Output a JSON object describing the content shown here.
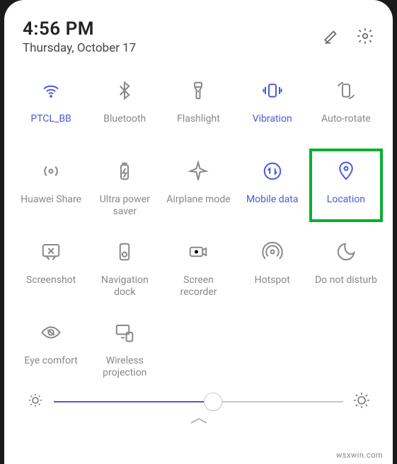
{
  "header": {
    "time": "4:56 PM",
    "date": "Thursday, October 17"
  },
  "tiles": [
    {
      "id": "wifi",
      "label": "PTCL_BB",
      "icon": "wifi",
      "active": true,
      "highlight": false
    },
    {
      "id": "bluetooth",
      "label": "Bluetooth",
      "icon": "bluetooth",
      "active": false,
      "highlight": false
    },
    {
      "id": "flashlight",
      "label": "Flashlight",
      "icon": "flashlight",
      "active": false,
      "highlight": false
    },
    {
      "id": "vibration",
      "label": "Vibration",
      "icon": "vibration",
      "active": true,
      "highlight": false
    },
    {
      "id": "autorotate",
      "label": "Auto-rotate",
      "icon": "autorotate",
      "active": false,
      "highlight": false
    },
    {
      "id": "huawei-share",
      "label": "Huawei Share",
      "icon": "huaweishare",
      "active": false,
      "highlight": false
    },
    {
      "id": "ultra-power",
      "label": "Ultra power\nsaver",
      "icon": "battery",
      "active": false,
      "highlight": false
    },
    {
      "id": "airplane",
      "label": "Airplane mode",
      "icon": "airplane",
      "active": false,
      "highlight": false
    },
    {
      "id": "mobile-data",
      "label": "Mobile data",
      "icon": "mobiledata",
      "active": true,
      "highlight": false
    },
    {
      "id": "location",
      "label": "Location",
      "icon": "location",
      "active": true,
      "highlight": true
    },
    {
      "id": "screenshot",
      "label": "Screenshot",
      "icon": "screenshot",
      "active": false,
      "highlight": false
    },
    {
      "id": "nav-dock",
      "label": "Navigation\ndock",
      "icon": "navdock",
      "active": false,
      "highlight": false
    },
    {
      "id": "screen-rec",
      "label": "Screen\nrecorder",
      "icon": "screenrec",
      "active": false,
      "highlight": false
    },
    {
      "id": "hotspot",
      "label": "Hotspot",
      "icon": "hotspot",
      "active": false,
      "highlight": false
    },
    {
      "id": "dnd",
      "label": "Do not disturb",
      "icon": "dnd",
      "active": false,
      "highlight": false
    },
    {
      "id": "eye-comfort",
      "label": "Eye comfort",
      "icon": "eyecomfort",
      "active": false,
      "highlight": false
    },
    {
      "id": "wireless-proj",
      "label": "Wireless\nprojection",
      "icon": "wirelessproj",
      "active": false,
      "highlight": false
    }
  ],
  "brightness": {
    "value": 55
  },
  "watermark": "wsxwin.com",
  "colors": {
    "accent": "#4a5bd8",
    "highlight": "#08b030"
  }
}
